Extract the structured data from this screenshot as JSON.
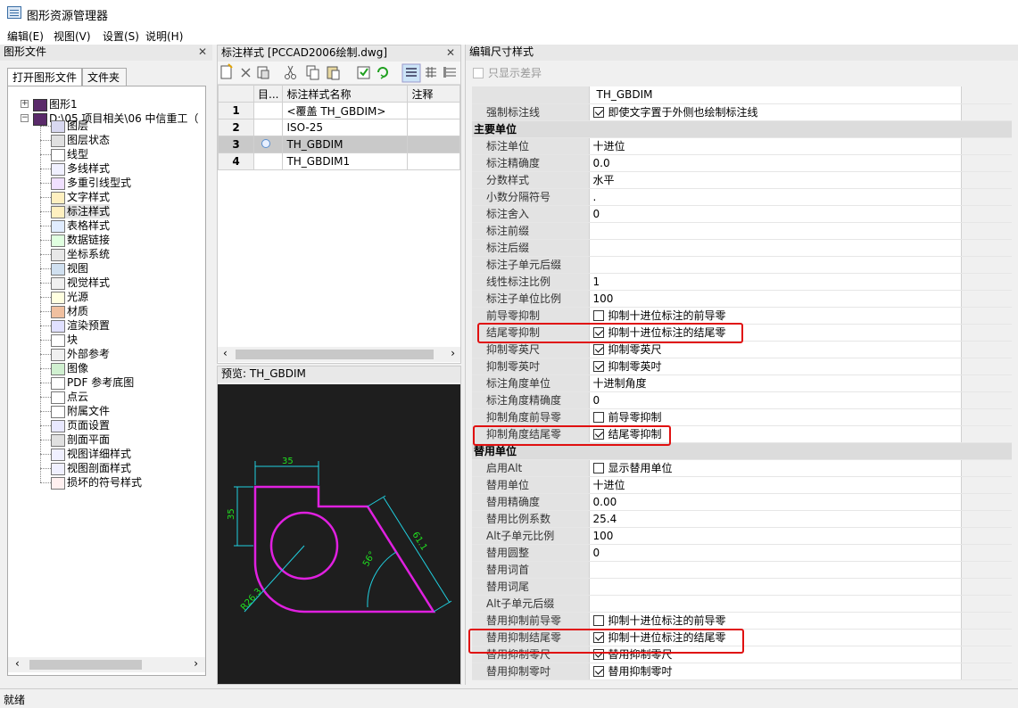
{
  "window": {
    "title": "图形资源管理器"
  },
  "menu": [
    "编辑(E)",
    "视图(V)",
    "设置(S)",
    "说明(H)"
  ],
  "left_panel": {
    "title": "图形文件",
    "tabs": [
      "打开图形文件",
      "文件夹"
    ],
    "tree_roots": [
      "图形1",
      "D:\\05 项目相关\\06 中信重工（"
    ],
    "tree_items": [
      "图层",
      "图层状态",
      "线型",
      "多线样式",
      "多重引线型式",
      "文字样式",
      "标注样式",
      "表格样式",
      "数据链接",
      "坐标系统",
      "视图",
      "视觉样式",
      "光源",
      "材质",
      "渲染预置",
      "块",
      "外部参考",
      "图像",
      "PDF 参考底图",
      "点云",
      "附属文件",
      "页面设置",
      "剖面平面",
      "视图详细样式",
      "视图剖面样式",
      "损坏的符号样式"
    ]
  },
  "mid_panel": {
    "title": "标注样式 [PCCAD2006绘制.dwg]",
    "columns": [
      "目...",
      "标注样式名称",
      "注释"
    ],
    "rows": [
      {
        "n": "1",
        "name": "<覆盖 TH_GBDIM>"
      },
      {
        "n": "2",
        "name": "ISO-25"
      },
      {
        "n": "3",
        "name": "TH_GBDIM"
      },
      {
        "n": "4",
        "name": "TH_GBDIM1"
      }
    ],
    "selected_row": 3
  },
  "preview": {
    "title": "预览: TH_GBDIM",
    "dims": [
      "35",
      "35",
      "61.1",
      "56°",
      "R26.3"
    ]
  },
  "right_panel": {
    "title": "编辑尺寸样式",
    "only_diff_label": "只显示差异",
    "header_value": "TH_GBDIM",
    "rows": [
      {
        "k": "强制标注线",
        "v": "即使文字置于外侧也绘制标注线",
        "cb": true
      },
      {
        "section": "主要单位"
      },
      {
        "k": "标注单位",
        "v": "十进位"
      },
      {
        "k": "标注精确度",
        "v": "0.0"
      },
      {
        "k": "分数样式",
        "v": "水平"
      },
      {
        "k": "小数分隔符号",
        "v": "."
      },
      {
        "k": "标注舍入",
        "v": "0"
      },
      {
        "k": "标注前缀",
        "v": ""
      },
      {
        "k": "标注后缀",
        "v": ""
      },
      {
        "k": "标注子单元后缀",
        "v": ""
      },
      {
        "k": "线性标注比例",
        "v": "1"
      },
      {
        "k": "标注子单位比例",
        "v": "100"
      },
      {
        "k": "前导零抑制",
        "v": "抑制十进位标注的前导零",
        "cb": false
      },
      {
        "k": "结尾零抑制",
        "v": "抑制十进位标注的结尾零",
        "cb": true
      },
      {
        "k": "抑制零英尺",
        "v": "抑制零英尺",
        "cb": true
      },
      {
        "k": "抑制零英吋",
        "v": "抑制零英吋",
        "cb": true
      },
      {
        "k": "标注角度单位",
        "v": "十进制角度"
      },
      {
        "k": "标注角度精确度",
        "v": "0"
      },
      {
        "k": "抑制角度前导零",
        "v": "前导零抑制",
        "cb": false
      },
      {
        "k": "抑制角度结尾零",
        "v": "结尾零抑制",
        "cb": true
      },
      {
        "section": "替用单位"
      },
      {
        "k": "启用Alt",
        "v": "显示替用单位",
        "cb": false
      },
      {
        "k": "替用单位",
        "v": "十进位"
      },
      {
        "k": "替用精确度",
        "v": "0.00"
      },
      {
        "k": "替用比例系数",
        "v": "25.4"
      },
      {
        "k": "Alt子单元比例",
        "v": "100"
      },
      {
        "k": "替用圆整",
        "v": "0"
      },
      {
        "k": "替用词首",
        "v": ""
      },
      {
        "k": "替用词尾",
        "v": ""
      },
      {
        "k": "Alt子单元后缀",
        "v": ""
      },
      {
        "k": "替用抑制前导零",
        "v": "抑制十进位标注的前导零",
        "cb": false
      },
      {
        "k": "替用抑制结尾零",
        "v": "抑制十进位标注的结尾零",
        "cb": true
      },
      {
        "k": "替用抑制零尺",
        "v": "替用抑制零尺",
        "cb": true
      },
      {
        "k": "替用抑制零吋",
        "v": "替用抑制零吋",
        "cb": true
      }
    ]
  },
  "status": "就绪",
  "colors": {
    "accent_highlight": "#e01010",
    "preview_bg": "#1e1e1e",
    "shape": "#e020e0",
    "dim_line": "#20d0e0",
    "dim_text": "#20e020"
  }
}
